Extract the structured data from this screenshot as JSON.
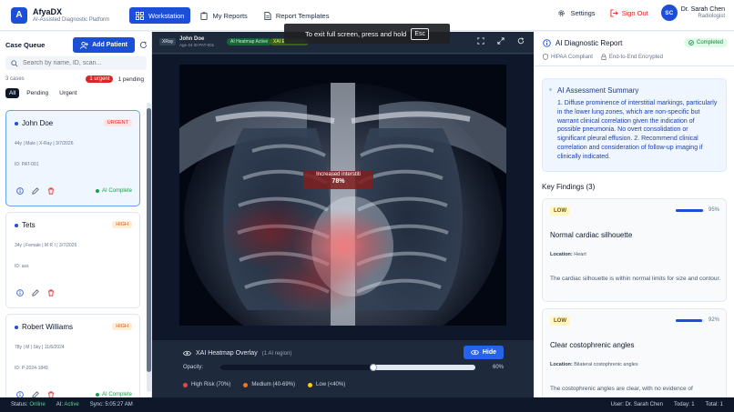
{
  "app": {
    "logo_letter": "A",
    "name": "AfyaDX",
    "subtitle": "AI-Assisted Diagnostic Platform"
  },
  "nav": {
    "items": [
      {
        "label": "Workstation",
        "icon": "grid-icon",
        "active": true
      },
      {
        "label": "My Reports",
        "icon": "clipboard-icon",
        "active": false
      },
      {
        "label": "Report Templates",
        "icon": "file-icon",
        "active": false
      }
    ],
    "settings_label": "Settings",
    "signout_label": "Sign Out"
  },
  "user": {
    "initials": "SC",
    "name": "Dr. Sarah Chen",
    "role": "Radiologist"
  },
  "fullscreen_toast": {
    "text": "To exit full screen, press and hold",
    "key": "Esc"
  },
  "sidebar": {
    "title": "Case Queue",
    "add_label": "Add Patient",
    "search_placeholder": "Search by name, ID, scan...",
    "case_count": "3 cases",
    "urgent_badge": "1 urgent",
    "pending_badge": "1 pending",
    "filters": [
      "All",
      "Pending",
      "Urgent"
    ],
    "cases": [
      {
        "name": "John Doe",
        "priority": "URGENT",
        "meta": "44y  |  Male  |  X-Ray  |  3/7/2026",
        "id": "ID: PAT-001",
        "status": "AI Complete"
      },
      {
        "name": "Tets",
        "priority": "HIGH",
        "meta": "34y  |  Female  |  M R I  |  3/7/2026",
        "id": "ID: ass",
        "status": ""
      },
      {
        "name": "Robert Williams",
        "priority": "HIGH",
        "meta": "78y  |  M  |  Sky  |  11/6/2024",
        "id": "ID: P-2024-1849",
        "status": "AI Complete"
      }
    ]
  },
  "viewer": {
    "modality": "XRay",
    "patient_name": "John Doe",
    "patient_meta": "Age 44  ID PAT-001",
    "chip_heatmap": "AI Heatmap Active",
    "chip_xai": "XAI Explainable",
    "annotation_label": "Increased interstiti",
    "annotation_pct": "78%",
    "overlay_title": "XAI Heatmap Overlay",
    "overlay_count": "(1 AI region)",
    "hide_label": "Hide",
    "opacity_label": "Opacity:",
    "opacity_value": "60%",
    "opacity_fraction": 0.6,
    "legend": [
      {
        "label": "High Risk (70%)",
        "color": "#ef4444"
      },
      {
        "label": "Medium (40-69%)",
        "color": "#f97316"
      },
      {
        "label": "Low (<40%)",
        "color": "#facc15"
      }
    ]
  },
  "report": {
    "title": "AI Diagnostic Report",
    "status": "Completed",
    "compliance": [
      "HIPAA Compliant",
      "End-to-End Encrypted"
    ],
    "summary_title": "AI Assessment Summary",
    "summary_text": "1. Diffuse prominence of interstitial markings, particularly in the lower lung zones, which are non-specific but warrant clinical correlation given the indication of possible pneumonia. No overt consolidation or significant pleural effusion. 2. Recommend clinical correlation and consideration of follow-up imaging if clinically indicated.",
    "key_findings_title": "Key Findings (3)",
    "findings": [
      {
        "severity": "LOW",
        "confidence": "95%",
        "confidence_fraction": 0.95,
        "title": "Normal cardiac silhouette",
        "location_label": "Location:",
        "location": "Heart",
        "description": "The cardiac silhouette is within normal limits for size and contour."
      },
      {
        "severity": "LOW",
        "confidence": "92%",
        "confidence_fraction": 0.92,
        "title": "Clear costophrenic angles",
        "location_label": "Location:",
        "location": "Bilateral costophrenic angles",
        "description": "The costophrenic angles are clear, with no evidence of"
      }
    ]
  },
  "statusbar": {
    "status_label": "Status:",
    "status_value": "Online",
    "ai_label": "AI:",
    "ai_value": "Active",
    "sync": "Sync: 5:05:27 AM",
    "user": "User: Dr. Sarah Chen",
    "today": "Today: 1",
    "total": "Total: 1"
  },
  "colors": {
    "primary": "#1d4ed8",
    "danger": "#dc2626",
    "success": "#16a34a",
    "sidebar_bg": "#ffffff",
    "viewer_bg": "#1e293b"
  }
}
